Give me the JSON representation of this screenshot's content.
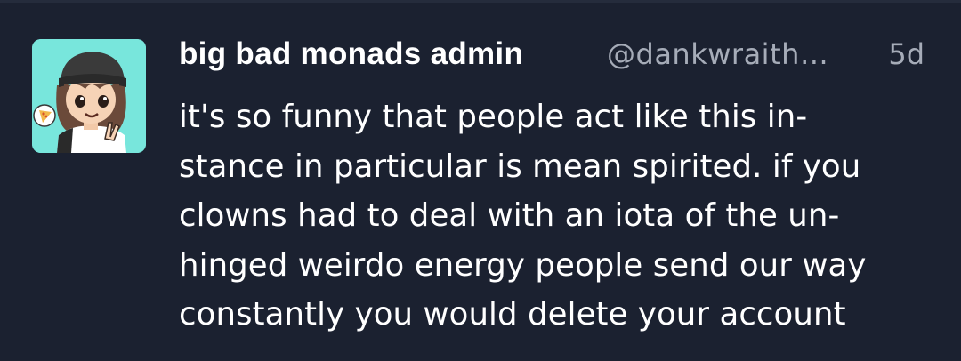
{
  "post": {
    "display_name": "big bad monads admin",
    "handle": "@dankwraith…",
    "timestamp": "5d",
    "body_lines": [
      "it's so funny that people act like this in-",
      "stance in particular is mean spirited. if you",
      "clowns had to deal with an iota of the un-",
      "hinged weirdo energy people send our way",
      "constantly you would delete your account"
    ],
    "avatar": {
      "icon": "avatar-icon",
      "background": "#78e6dc"
    }
  },
  "colors": {
    "background": "#1b2130",
    "text": "#ffffff",
    "muted": "#a6acb8"
  }
}
